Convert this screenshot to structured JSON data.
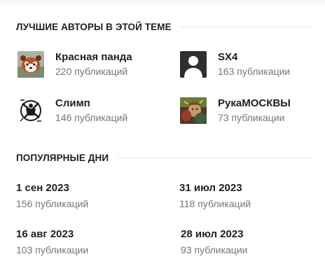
{
  "top_authors": {
    "title": "ЛУЧШИЕ АВТОРЫ В ЭТОЙ ТЕМЕ",
    "authors": [
      {
        "name": "Красная панда",
        "count": "220 публикаций"
      },
      {
        "name": "SX4",
        "count": "163 публикации"
      },
      {
        "name": "Слимп",
        "count": "146 публикаций"
      },
      {
        "name": "РукаМОСКВЫ",
        "count": "73 публикации"
      }
    ]
  },
  "popular_days": {
    "title": "ПОПУЛЯРНЫЕ ДНИ",
    "days": [
      {
        "date": "1 сен 2023",
        "count": "156 публикаций"
      },
      {
        "date": "31 июл 2023",
        "count": "118 публикаций"
      },
      {
        "date": "16 авг 2023",
        "count": "103 публикации"
      },
      {
        "date": "28 июл 2023",
        "count": "93 публикации"
      }
    ]
  }
}
